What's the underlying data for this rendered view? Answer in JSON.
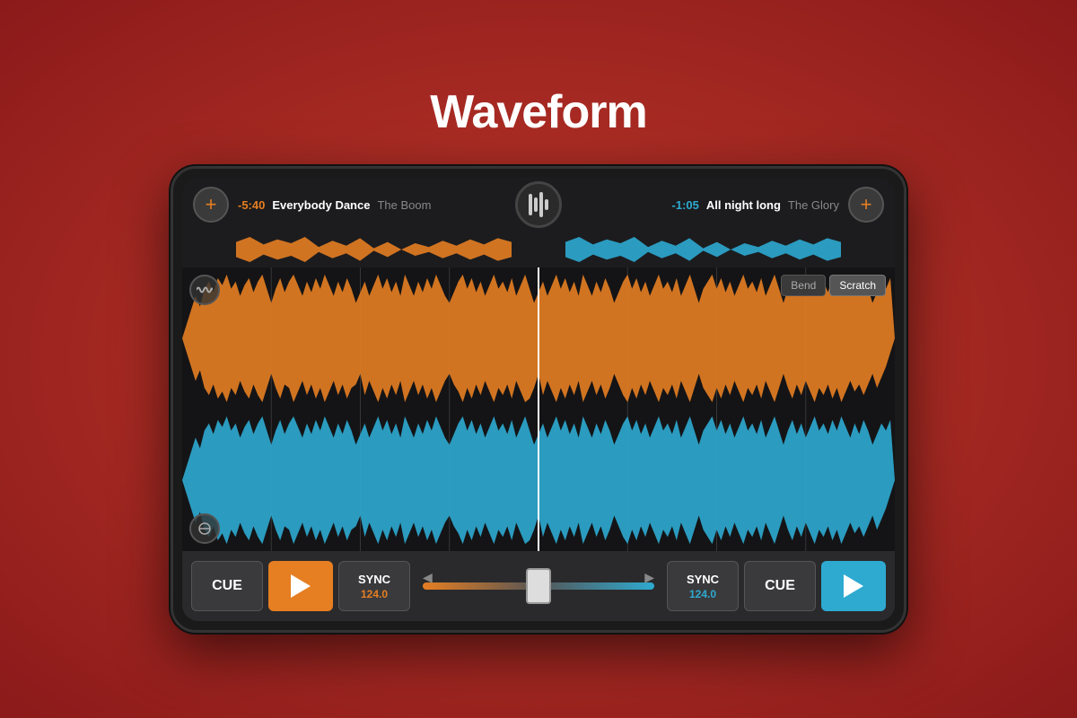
{
  "page": {
    "title": "Waveform",
    "background": "#c0392b"
  },
  "header": {
    "left_add_label": "+",
    "right_add_label": "+"
  },
  "deck_left": {
    "time": "-5:40",
    "track_title": "Everybody Dance",
    "track_artist": "The Boom",
    "cue_label": "CUE",
    "sync_label": "SYNC",
    "bpm": "124.0",
    "play_label": "▶"
  },
  "deck_right": {
    "time": "-1:05",
    "track_title": "All night long",
    "track_artist": "The Glory",
    "cue_label": "CUE",
    "sync_label": "SYNC",
    "bpm": "124.0",
    "play_label": "▶"
  },
  "controls": {
    "bend_label": "Bend",
    "scratch_label": "Scratch"
  },
  "colors": {
    "orange": "#e67e22",
    "blue": "#2eaad1",
    "bg_dark": "#141416",
    "panel_bg": "#2a2a2c"
  }
}
